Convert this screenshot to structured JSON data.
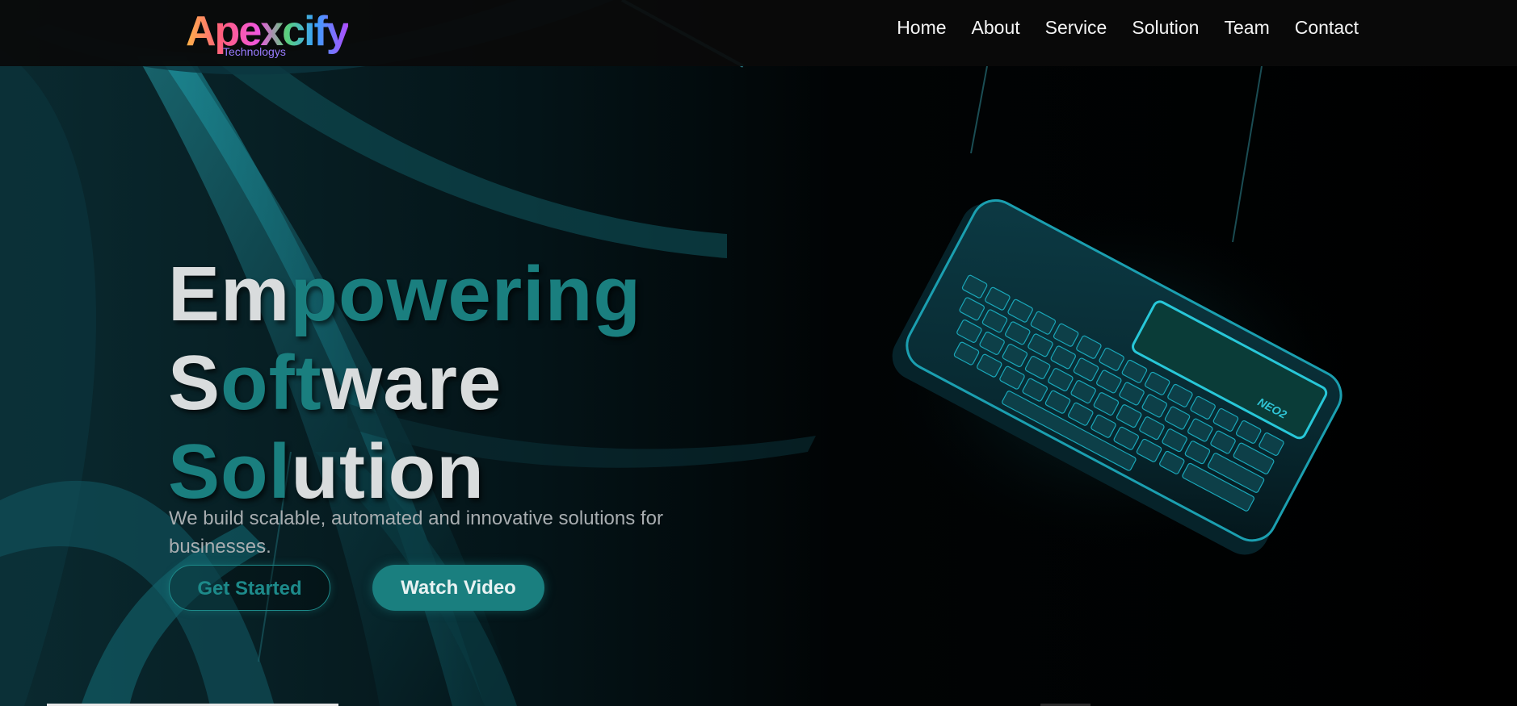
{
  "brand": {
    "name": "Apexcify",
    "tagline": "Technologys"
  },
  "nav": {
    "items": [
      "Home",
      "About",
      "Service",
      "Solution",
      "Team",
      "Contact"
    ]
  },
  "hero": {
    "title_lines": [
      [
        {
          "text": "Em",
          "accent": false
        },
        {
          "text": "powering",
          "accent": true
        }
      ],
      [
        {
          "text": "S",
          "accent": false
        },
        {
          "text": "oft",
          "accent": true
        },
        {
          "text": "ware",
          "accent": false
        }
      ],
      [
        {
          "text": "Sol",
          "accent": true
        },
        {
          "text": "ution",
          "accent": false
        }
      ]
    ],
    "description": "We build scalable, automated and innovative solutions for businesses.",
    "primary_button": "Get Started",
    "secondary_button": "Watch Video",
    "device_label": "NEO2"
  },
  "colors": {
    "accent": "#1a7f7f",
    "title_light": "#d9dcdd",
    "nav_bg": "#0a0a0a",
    "text_muted": "#a8adb0"
  },
  "icons": {
    "hero_image": "keyboard-device-icon"
  }
}
